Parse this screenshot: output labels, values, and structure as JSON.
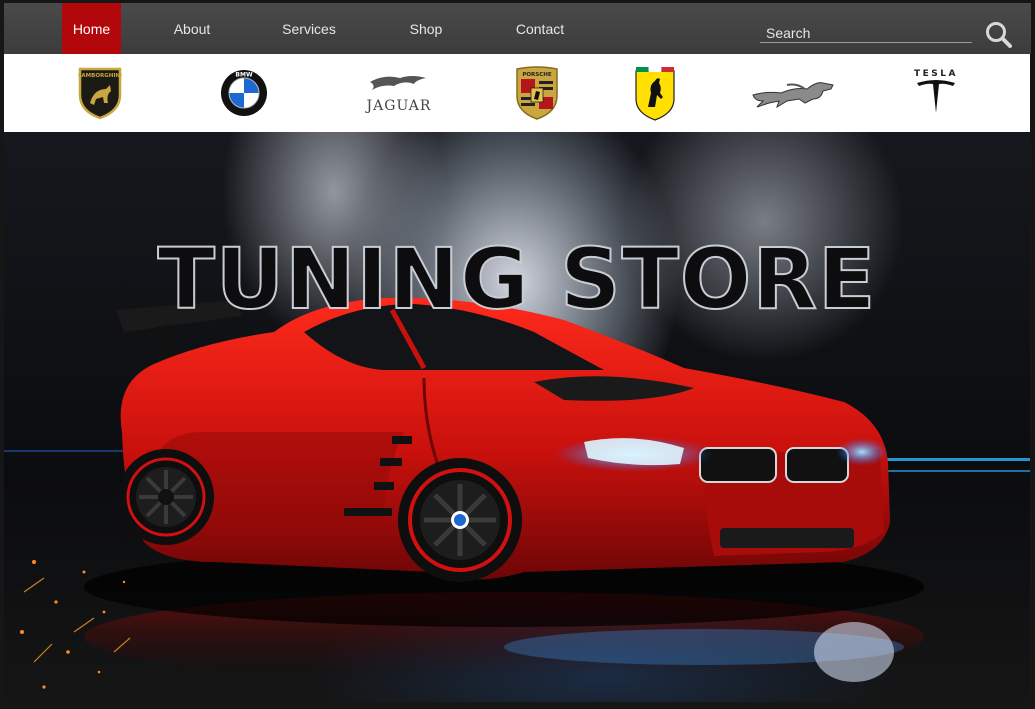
{
  "nav": {
    "items": [
      {
        "label": "Home",
        "active": true
      },
      {
        "label": "About",
        "active": false
      },
      {
        "label": "Services",
        "active": false
      },
      {
        "label": "Shop",
        "active": false
      },
      {
        "label": "Contact",
        "active": false
      }
    ],
    "search_placeholder": "Search",
    "search_icon": "search-icon"
  },
  "brands": {
    "lamborghini": "LAMBORGHINI",
    "bmw": "BMW",
    "jaguar": "JAGUAR",
    "porsche": "PORSCHE",
    "ferrari": "ferrari-logo",
    "mustang": "mustang-logo",
    "tesla": "TESLA"
  },
  "hero": {
    "title": "TUNING STORE"
  },
  "colors": {
    "nav_bg": "#404040",
    "active": "#b3080b",
    "car_red": "#d21010",
    "headlight_blue": "#2bb8ff"
  }
}
